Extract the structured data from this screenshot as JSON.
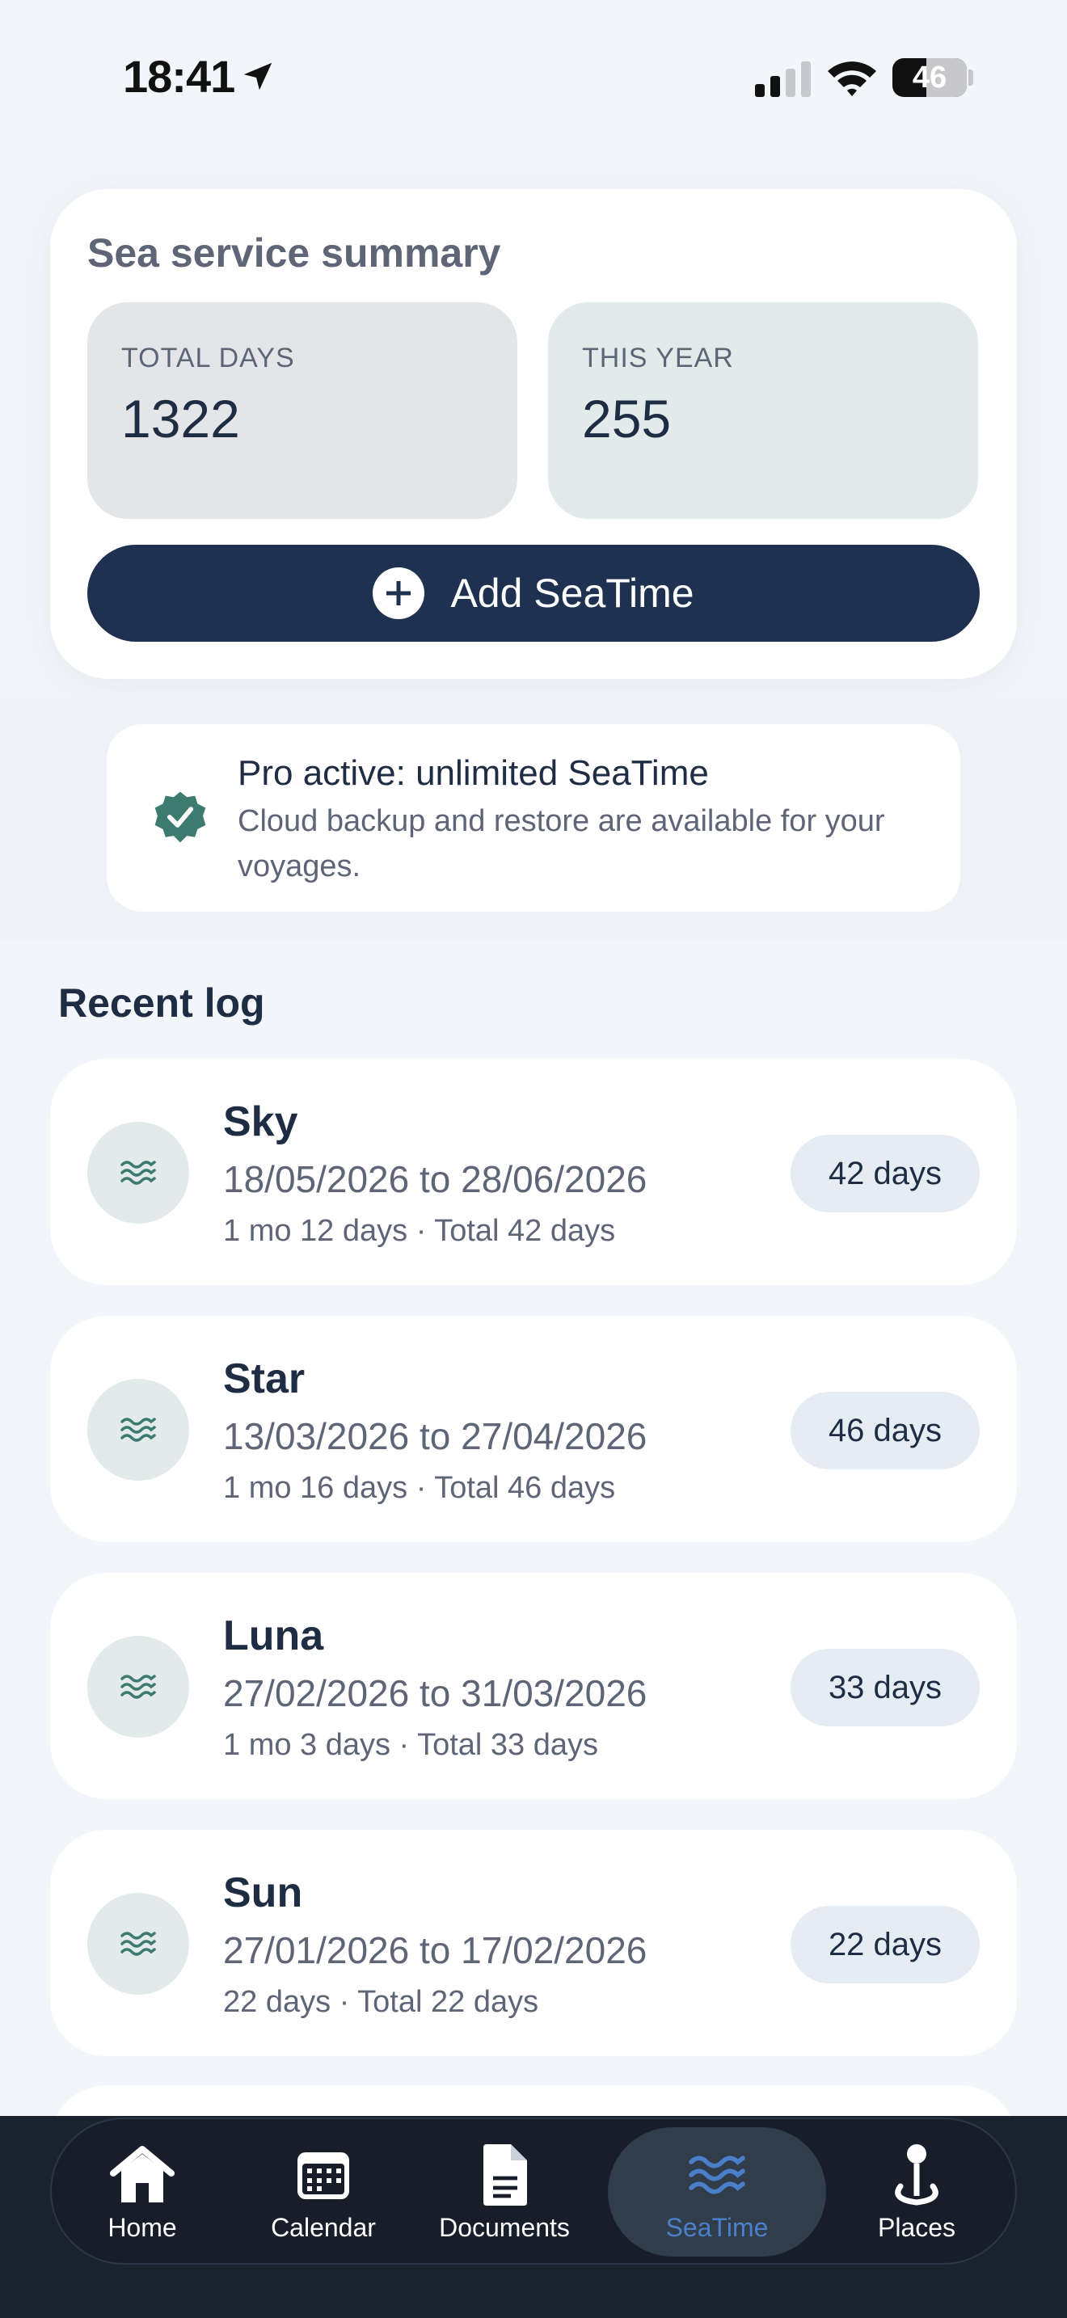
{
  "status_bar": {
    "time": "18:41",
    "battery": "46",
    "battery_level": 0.46
  },
  "summary": {
    "title": "Sea service summary",
    "total_days_label": "TOTAL DAYS",
    "total_days_value": "1322",
    "this_year_label": "THIS YEAR",
    "this_year_value": "255",
    "add_button_label": "Add SeaTime"
  },
  "pro": {
    "title": "Pro active: unlimited SeaTime",
    "text": "Cloud backup and restore are available for your voyages."
  },
  "recent": {
    "title": "Recent log",
    "items": [
      {
        "name": "Sky",
        "range": "18/05/2026 to 28/06/2026",
        "detail": "1 mo 12 days · Total 42 days",
        "days": "42 days"
      },
      {
        "name": "Star",
        "range": "13/03/2026 to 27/04/2026",
        "detail": "1 mo 16 days · Total 46 days",
        "days": "46 days"
      },
      {
        "name": "Luna",
        "range": "27/02/2026 to 31/03/2026",
        "detail": "1 mo 3 days · Total 33 days",
        "days": "33 days"
      },
      {
        "name": "Sun",
        "range": "27/01/2026 to 17/02/2026",
        "detail": "22 days · Total 22 days",
        "days": "22 days"
      }
    ]
  },
  "tabs": [
    {
      "label": "Home",
      "icon": "home-icon",
      "active": false
    },
    {
      "label": "Calendar",
      "icon": "calendar-icon",
      "active": false
    },
    {
      "label": "Documents",
      "icon": "document-icon",
      "active": false
    },
    {
      "label": "SeaTime",
      "icon": "waves-icon",
      "active": true
    },
    {
      "label": "Places",
      "icon": "location-pin-icon",
      "active": false
    }
  ],
  "colors": {
    "accent": "#1f3150",
    "active_tab": "#4a7fc9",
    "badge": "#3d7a70"
  }
}
